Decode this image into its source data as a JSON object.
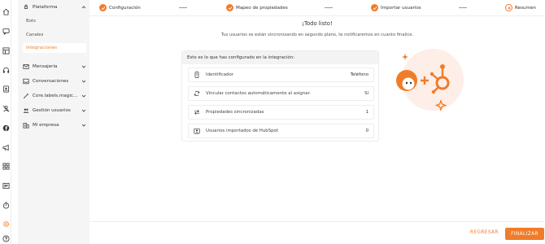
{
  "rail": {
    "icons": [
      "home-icon",
      "chat-icon",
      "dashboard-icon",
      "headset-icon",
      "contacts-icon",
      "no-people-icon",
      "facebook-icon",
      "megaphone-icon",
      "apps-icon",
      "notes-icon",
      "timer-icon",
      "settings-icon",
      "help-icon"
    ]
  },
  "sidebar": {
    "platform": "Plataforma",
    "bots": "Bots",
    "channels": "Canales",
    "integrations": "Integraciones",
    "messaging": "Mensajería",
    "conversations": "Conversaciones",
    "core_labels": "Core.labels.magic_ato",
    "user_management": "Gestión usuarios",
    "my_company": "Mi empresa"
  },
  "stepper": {
    "steps": [
      {
        "label": "Configuración"
      },
      {
        "label": "Mapeo de propiedades"
      },
      {
        "label": "Importar usuarios"
      },
      {
        "label": "Resumen"
      }
    ]
  },
  "main": {
    "title": "¡Todo listo!",
    "subtitle": "Tus usuarios se están sincronizando en segundo plano, te notificaremos en cuanto finalice.",
    "card_header": "Esto es lo que has configurado en la integración:",
    "rows": [
      {
        "label": "Identificador",
        "value": "Teléfono",
        "icon": "phone-id-icon"
      },
      {
        "label": "Vincular contactos automáticamente al asignar.",
        "value": "Sí",
        "icon": "sync-icon"
      },
      {
        "label": "Propiedades sincronizadas",
        "value": "1",
        "icon": "swap-icon"
      },
      {
        "label": "Usuarios importados de HubSpot",
        "value": "0",
        "icon": "user-card-icon"
      }
    ]
  },
  "footer": {
    "back": "REGRESAR",
    "finish": "FINALIZAR"
  },
  "colors": {
    "accent": "#f07c2a",
    "sidebar_bg": "#f5f5f6"
  }
}
